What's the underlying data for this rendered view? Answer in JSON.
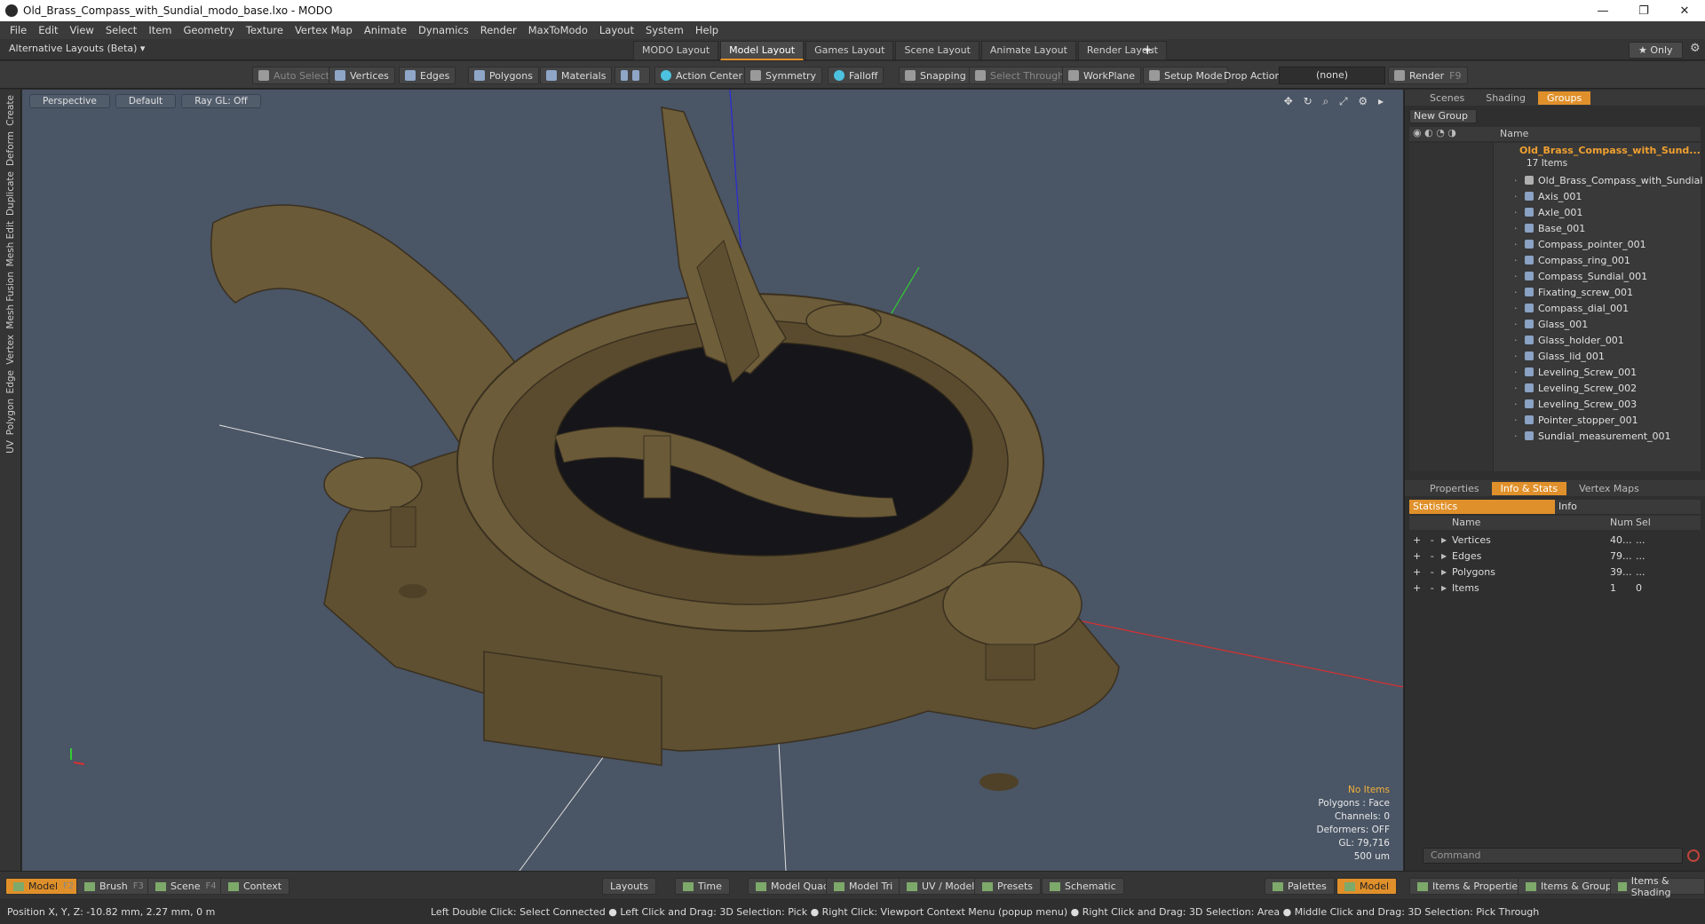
{
  "window": {
    "title": "Old_Brass_Compass_with_Sundial_modo_base.lxo - MODO",
    "min": "—",
    "max": "❐",
    "close": "✕"
  },
  "menu": [
    "File",
    "Edit",
    "View",
    "Select",
    "Item",
    "Geometry",
    "Texture",
    "Vertex Map",
    "Animate",
    "Dynamics",
    "Render",
    "MaxToModo",
    "Layout",
    "System",
    "Help"
  ],
  "layoutbar": {
    "alt_layouts": "Alternative Layouts (Beta) ▾",
    "tabs": [
      "MODO Layout",
      "Model Layout",
      "Games Layout",
      "Scene Layout",
      "Animate Layout",
      "Render Layout"
    ],
    "active_tab": "Model Layout",
    "plus": "+",
    "only": "★ Only",
    "gear": "⚙"
  },
  "toolbar": {
    "auto_select": "Auto Select",
    "vertices": "Vertices",
    "edges": "Edges",
    "polygons": "Polygons",
    "materials": "Materials",
    "action_center": "Action Center",
    "symmetry": "Symmetry",
    "falloff": "Falloff",
    "snapping": "Snapping",
    "select_through": "Select Through",
    "workplane": "WorkPlane",
    "setup_mode": "Setup Mode",
    "drop_action_label": "Drop Action",
    "drop_action_value": "(none)",
    "render": "Render",
    "render_key": "F9"
  },
  "left_tabs": [
    "Create",
    "Deform",
    "Duplicate",
    "Mesh Edit",
    "Mesh Fusion",
    "Vertex",
    "Edge",
    "Polygon",
    "UV"
  ],
  "viewport": {
    "view": "Perspective",
    "shading": "Default",
    "raygl": "Ray GL: Off",
    "icons": "✥ ↻ ⌕ ⤢ ⚙ ▸",
    "stats": {
      "no_items": "No Items",
      "polygons": "Polygons : Face",
      "channels": "Channels: 0",
      "deformers": "Deformers: OFF",
      "gl": "GL: 79,716",
      "scale": "500 um"
    }
  },
  "scene_panel": {
    "tabs": [
      "Scenes",
      "Shading",
      "Groups"
    ],
    "active_tab": "Groups",
    "new_group": "New Group",
    "col_name": "Name",
    "root": "Old_Brass_Compass_with_Sund...",
    "root_count": "17 Items",
    "items": [
      "Old_Brass_Compass_with_Sundial",
      "Axis_001",
      "Axle_001",
      "Base_001",
      "Compass_pointer_001",
      "Compass_ring_001",
      "Compass_Sundial_001",
      "Fixating_screw_001",
      "Compass_dial_001",
      "Glass_001",
      "Glass_holder_001",
      "Glass_lid_001",
      "Leveling_Screw_001",
      "Leveling_Screw_002",
      "Leveling_Screw_003",
      "Pointer_stopper_001",
      "Sundial_measurement_001"
    ]
  },
  "props_panel": {
    "tabs": [
      "Properties",
      "Info & Stats",
      "Vertex Maps"
    ],
    "active_tab": "Info & Stats",
    "subtabs": [
      "Statistics",
      "Info"
    ],
    "cols": {
      "name": "Name",
      "num": "Num",
      "sel": "Sel"
    },
    "rows": [
      {
        "name": "Vertices",
        "num": "40...",
        "sel": "..."
      },
      {
        "name": "Edges",
        "num": "79...",
        "sel": "..."
      },
      {
        "name": "Polygons",
        "num": "39...",
        "sel": "..."
      },
      {
        "name": "Items",
        "num": "1",
        "sel": "0"
      }
    ],
    "command_placeholder": "Command"
  },
  "bottombar": {
    "model": "Model",
    "model_key": "F2",
    "brush": "Brush",
    "brush_key": "F3",
    "scene": "Scene",
    "scene_key": "F4",
    "context": "Context",
    "layouts": "Layouts",
    "time": "Time",
    "model_quad": "Model Quad",
    "model_tri": "Model Tri",
    "uv_model": "UV / Model",
    "presets": "Presets",
    "schematic": "Schematic",
    "palettes": "Palettes",
    "model_right": "Model",
    "items_props": "Items & Properties",
    "items_groups": "Items & Groups",
    "items_shading": "Items & Shading"
  },
  "status": {
    "position": "Position X, Y, Z:   -10.82 mm, 2.27 mm, 0 m",
    "hint": "Left Double Click: Select Connected ● Left Click and Drag: 3D Selection: Pick ● Right Click: Viewport Context Menu (popup menu) ● Right Click and Drag: 3D Selection: Area ● Middle Click and Drag: 3D Selection: Pick Through"
  }
}
